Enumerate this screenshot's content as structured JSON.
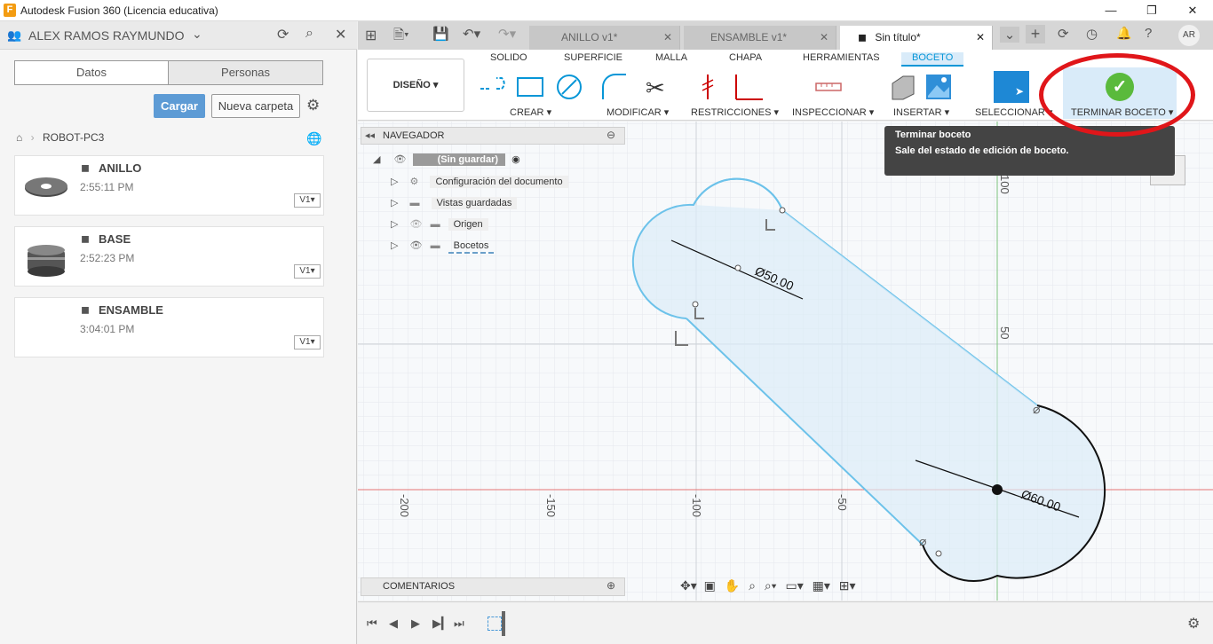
{
  "window": {
    "title": "Autodesk Fusion 360 (Licencia educativa)",
    "logo": "F"
  },
  "data_panel": {
    "user": "ALEX RAMOS RAYMUNDO",
    "toggle": [
      "Datos",
      "Personas"
    ],
    "upload_label": "Cargar",
    "new_folder_label": "Nueva carpeta",
    "project": "ROBOT-PC3",
    "files": [
      {
        "name": "ANILLO",
        "time": "2:55:11 PM",
        "version": "V1"
      },
      {
        "name": "BASE",
        "time": "2:52:23 PM",
        "version": "V1"
      },
      {
        "name": "ENSAMBLE",
        "time": "3:04:01 PM",
        "version": "V1"
      }
    ]
  },
  "doc_tabs": [
    "ANILLO v1*",
    "ENSAMBLE v1*",
    "Sin título*"
  ],
  "user_initials": "AR",
  "ribbon": {
    "workspace": "DISEÑO",
    "tabs": [
      "SOLIDO",
      "SUPERFICIE",
      "MALLA",
      "CHAPA",
      "HERRAMIENTAS",
      "BOCETO"
    ],
    "groups": [
      "CREAR",
      "MODIFICAR",
      "RESTRICCIONES",
      "INSPECCIONAR",
      "INSERTAR",
      "SELECCIONAR",
      "TERMINAR BOCETO"
    ]
  },
  "browser": {
    "title": "NAVEGADOR",
    "root": "(Sin guardar)",
    "items": [
      "Configuración del documento",
      "Vistas guardadas",
      "Origen",
      "Bocetos"
    ]
  },
  "tooltip": {
    "title": "Terminar boceto",
    "desc": "Sale del estado de edición de boceto."
  },
  "sketch": {
    "dims": [
      "Ø50.00",
      "Ø60.00"
    ],
    "x_ticks": [
      "-200",
      "-150",
      "-100",
      "-50"
    ],
    "y_ticks": [
      "100",
      "50"
    ]
  },
  "comments_label": "COMENTARIOS",
  "colors": {
    "accent": "#0696d7",
    "upload": "#5d9bd5",
    "annotation": "#e0161a"
  }
}
